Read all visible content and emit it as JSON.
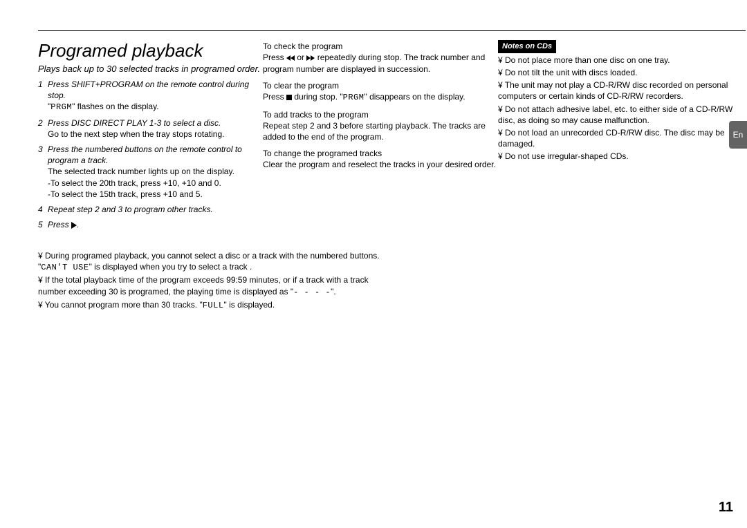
{
  "title": "Programed playback",
  "subtitle": "Plays back up to 30 selected tracks in programed order.",
  "steps": {
    "s1_head": "Press SHIFT+PROGRAM on the remote control during stop.",
    "s1_sub": "\" flashes on the display.",
    "s1_code": "PRGM",
    "s2_head": "Press DISC DIRECT PLAY 1-3 to select a disc.",
    "s2_sub": "Go to the next step when the tray stops rotating.",
    "s3_head": "Press the numbered buttons on the remote control to program a track.",
    "s3_sub1": "The selected track number lights up on the display.",
    "s3_sub2": "-To select the 20th track, press +10, +10 and 0.",
    "s3_sub3": "-To select the 15th track, press +10 and 5.",
    "s4_head": "Repeat step 2 and 3 to program other tracks.",
    "s5_head": "Press ",
    "s5_tail": "."
  },
  "bullets": {
    "b1a": "¥ During programed playback, you cannot  select a disc or a track with the numbered buttons. \"",
    "b1code": "CAN'T USE",
    "b1b": "\" is displayed when you try to select a track .",
    "b2": "¥ If the total playback time of the program exceeds 99:59 minutes, or if a track with a track number exceeding 30 is programed, the playing time is displayed as \"",
    "b2code": "- - - -",
    "b2b": "\".",
    "b3a": "¥ You cannot program more than 30 tracks. \"",
    "b3code": "FULL",
    "b3b": "\" is displayed."
  },
  "col2": {
    "check_h": "To check the program",
    "check_a": "Press ",
    "check_mid": " or ",
    "check_b": " repeatedly during stop. The track number and program number are displayed in succession.",
    "clear_h": "To clear the program",
    "clear_a": "Press ",
    "clear_mid": " during stop. \"",
    "clear_code": "PRGM",
    "clear_b": "\" disappears on the display.",
    "add_h": "To add tracks to the program",
    "add_b": "Repeat step 2 and 3 before starting playback. The tracks are added to the end of the program.",
    "change_h": "To change the programed tracks",
    "change_b": "Clear the program and reselect the tracks in your desired order."
  },
  "col3": {
    "header": "Notes on CDs",
    "n1": "¥ Do not place more than one disc on one tray.",
    "n2": "¥ Do not tilt the unit with discs loaded.",
    "n3": "¥ The unit may not play a CD-R/RW disc recorded on personal computers or certain kinds of CD-R/RW recorders.",
    "n4": "¥ Do not attach adhesive label, etc. to either side of a CD-R/RW disc, as doing so may cause malfunction.",
    "n5": "¥ Do not load an unrecorded CD-R/RW disc. The disc may be damaged.",
    "n6": "¥ Do not use irregular-shaped CDs."
  },
  "page_number": "11",
  "lang_tab": "En"
}
